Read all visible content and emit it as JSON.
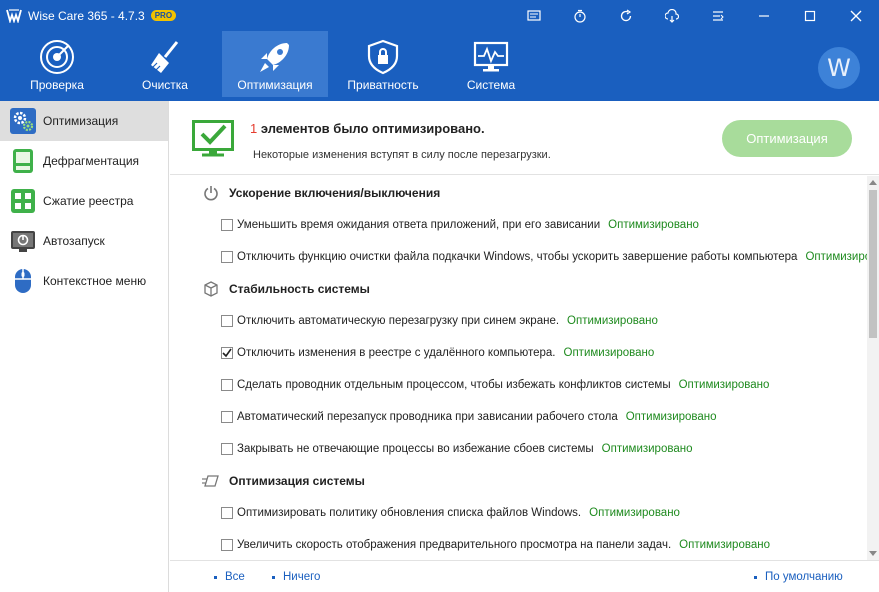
{
  "app": {
    "title": "Wise Care 365 - 4.7.3",
    "badge": "PRO"
  },
  "titlebar_icons": [
    "monitor-icon",
    "restore-icon",
    "refresh-icon",
    "cloud-icon",
    "menu-icon",
    "minimize-icon",
    "maximize-icon",
    "close-icon"
  ],
  "nav": [
    {
      "label": "Проверка",
      "icon": "radar-icon",
      "active": false
    },
    {
      "label": "Очистка",
      "icon": "broom-icon",
      "active": false
    },
    {
      "label": "Оптимизация",
      "icon": "rocket-icon",
      "active": true
    },
    {
      "label": "Приватность",
      "icon": "shield-icon",
      "active": false
    },
    {
      "label": "Система",
      "icon": "system-monitor-icon",
      "active": false
    }
  ],
  "avatar": {
    "letter": "W"
  },
  "sidebar": [
    {
      "label": "Оптимизация",
      "icon": "gear-icon",
      "active": true
    },
    {
      "label": "Дефрагментация",
      "icon": "disk-icon",
      "active": false
    },
    {
      "label": "Сжатие реестра",
      "icon": "registry-icon",
      "active": false
    },
    {
      "label": "Автозапуск",
      "icon": "startup-icon",
      "active": false
    },
    {
      "label": "Контекстное меню",
      "icon": "mouse-icon",
      "active": false
    }
  ],
  "header": {
    "count": "1",
    "title": " элементов было оптимизировано.",
    "subtitle": "Некоторые изменения вступят в силу после перезагрузки.",
    "button": "Оптимизация"
  },
  "sections": [
    {
      "title": "Ускорение включения/выключения",
      "icon": "power-icon",
      "items": [
        {
          "text": "Уменьшить время ожидания ответа приложений, при его зависании",
          "status": "Оптимизировано",
          "checked": false
        },
        {
          "text": "Отключить функцию очистки файла подкачки Windows, чтобы ускорить завершение работы компьютера",
          "status": "Оптимизиро...",
          "checked": false
        }
      ]
    },
    {
      "title": "Стабильность системы",
      "icon": "cube-icon",
      "items": [
        {
          "text": "Отключить автоматическую перезагрузку при синем экране.",
          "status": "Оптимизировано",
          "checked": false
        },
        {
          "text": "Отключить изменения в реестре с удалённого компьютера.",
          "status": "Оптимизировано",
          "checked": true
        },
        {
          "text": "Сделать проводник отдельным процессом, чтобы избежать конфликтов системы",
          "status": "Оптимизировано",
          "checked": false
        },
        {
          "text": "Автоматический перезапуск проводника при зависании рабочего стола",
          "status": "Оптимизировано",
          "checked": false
        },
        {
          "text": "Закрывать не отвечающие процессы во избежание сбоев системы",
          "status": "Оптимизировано",
          "checked": false
        }
      ]
    },
    {
      "title": "Оптимизация системы",
      "icon": "speed-icon",
      "items": [
        {
          "text": "Оптимизировать политику обновления списка файлов Windows.",
          "status": "Оптимизировано",
          "checked": false
        },
        {
          "text": "Увеличить скорость отображения предварительного просмотра на панели задач.",
          "status": "Оптимизировано",
          "checked": false
        }
      ]
    }
  ],
  "footer": {
    "all": "Все",
    "none": "Ничего",
    "default": "По умолчанию"
  }
}
